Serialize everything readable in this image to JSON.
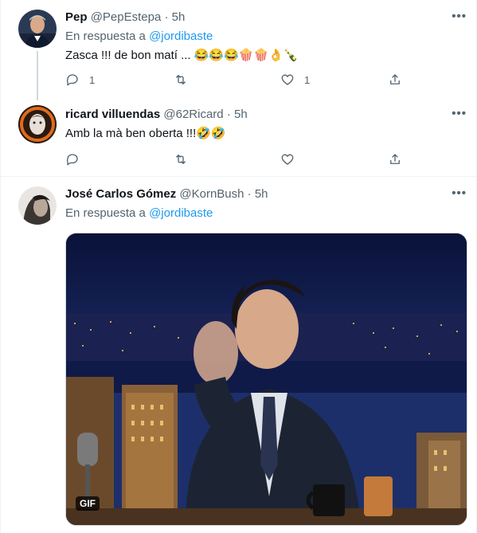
{
  "tweets": [
    {
      "name": "Pep",
      "handle": "@PepEstepa",
      "sep": "·",
      "time": "5h",
      "reply_prefix": "En respuesta a",
      "reply_handle": "@jordibaste",
      "text": "Zasca !!! de bon matí ... 😂😂😂🍿🍿👌🍾",
      "replies": "1",
      "retweets": "",
      "likes": "1"
    },
    {
      "name": "ricard villuendas",
      "handle": "@62Ricard",
      "sep": "·",
      "time": "5h",
      "text": "Amb la mà ben oberta !!!🤣🤣",
      "replies": "",
      "retweets": "",
      "likes": ""
    },
    {
      "name": "José Carlos Gómez",
      "handle": "@KornBush",
      "sep": "·",
      "time": "5h",
      "reply_prefix": "En respuesta a",
      "reply_handle": "@jordibaste",
      "media_badge": "GIF"
    }
  ],
  "more_label": "•••",
  "icons": [
    "reply-icon",
    "retweet-icon",
    "like-icon",
    "share-icon",
    "more-icon"
  ],
  "colors": {
    "link": "#1d9bf0",
    "muted": "#536471",
    "text": "#0f1419"
  }
}
